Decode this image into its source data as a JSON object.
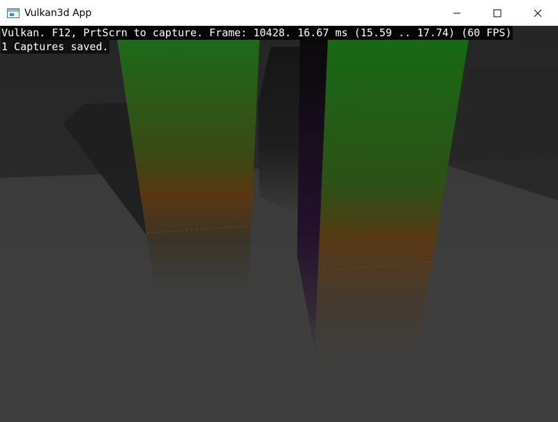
{
  "window": {
    "title": "Vulkan3d App",
    "icon": "app-window-icon",
    "buttons": {
      "minimize_icon": "minimize-icon",
      "maximize_icon": "maximize-icon",
      "close_icon": "close-icon"
    }
  },
  "overlay": {
    "status_line": "Vulkan. F12, PrtScrn to capture. Frame: 10428. 16.67 ms (15.59 .. 17.74) (60 FPS)",
    "captures_line": "1 Captures saved."
  },
  "colors": {
    "background": "#2c2c2c",
    "pillar_top": "#1f6b1f",
    "pillar_bottom": "#6b3a12",
    "dark_pillar": "#1a1a1a",
    "overlay_text": "#ffffff"
  }
}
